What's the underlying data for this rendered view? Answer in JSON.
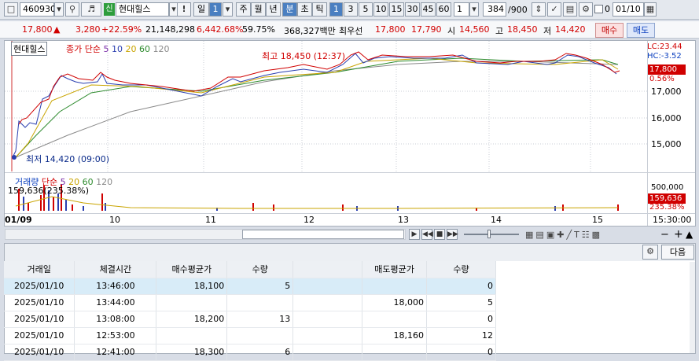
{
  "toolbar": {
    "code": "460930",
    "badge": "신",
    "stock_name": "현대힐스",
    "excl": "!",
    "period_sel": "일",
    "period_num": "1",
    "period_labels": [
      "주",
      "월",
      "년"
    ],
    "mode_sel": "분",
    "mode_labels": [
      "초",
      "틱"
    ],
    "intervals": [
      "1",
      "3",
      "5",
      "10",
      "15",
      "30",
      "45",
      "60"
    ],
    "interval_value": "1",
    "count_current": "384",
    "count_total": "/900",
    "date_value": "01/10",
    "check_label": "0"
  },
  "quote": {
    "price": "17,800",
    "arrow": "▲",
    "change": "3,280",
    "change_pct": "+22.59%",
    "volume": "21,148,298",
    "vol_pct": "6,442.68%",
    "turnover": "59.75%",
    "amount": "368,327백만",
    "priority_label": "최우선",
    "ask": "17,800",
    "bid": "17,790",
    "open_label": "시",
    "open": "14,560",
    "high_label": "고",
    "high": "18,450",
    "low_label": "저",
    "low": "14,420",
    "buy_label": "매수",
    "sell_label": "매도"
  },
  "chart": {
    "name": "현대힐스",
    "ma_label": "종가 단순",
    "ma_periods": [
      "5",
      "10",
      "20",
      "60",
      "120"
    ],
    "ma_colors": [
      "#7a2da8",
      "#2a3fb0",
      "#c9a400",
      "#2e8b2e",
      "#8a8a8a"
    ],
    "high_annot": "최고 18,450 (12:37)",
    "low_annot": "최저 14,420 (09:00)",
    "lc": "LC:23.44",
    "hc": "HC:-3.52",
    "last_price": "17,800",
    "last_pct": "0.56%",
    "y_ticks": [
      "17,000",
      "16,000",
      "15,000"
    ],
    "x_labels": [
      "01/09",
      "10",
      "11",
      "12",
      "13",
      "14",
      "15"
    ],
    "time_label": "15:30:00"
  },
  "volume": {
    "title": "거래량",
    "ma_label": "단순",
    "ma_periods": [
      "5",
      "20",
      "60",
      "120"
    ],
    "value_text": "159,636(235.38%)",
    "y_tick": "500,000",
    "last_vol": "159,636",
    "last_pct": "235.38%"
  },
  "bottom": {
    "next_label": "다음"
  },
  "table": {
    "headers": [
      "거래일",
      "체결시간",
      "매수평균가",
      "수량",
      "",
      "매도평균가",
      "수량"
    ],
    "rows": [
      [
        "2025/01/10",
        "13:46:00",
        "18,100",
        "5",
        "",
        "",
        "0"
      ],
      [
        "2025/01/10",
        "13:44:00",
        "",
        "",
        "",
        "18,000",
        "5"
      ],
      [
        "2025/01/10",
        "13:08:00",
        "18,200",
        "13",
        "",
        "",
        "0"
      ],
      [
        "2025/01/10",
        "12:53:00",
        "",
        "",
        "",
        "18,160",
        "12"
      ],
      [
        "2025/01/10",
        "12:41:00",
        "18,300",
        "6",
        "",
        "",
        "0"
      ]
    ]
  }
}
